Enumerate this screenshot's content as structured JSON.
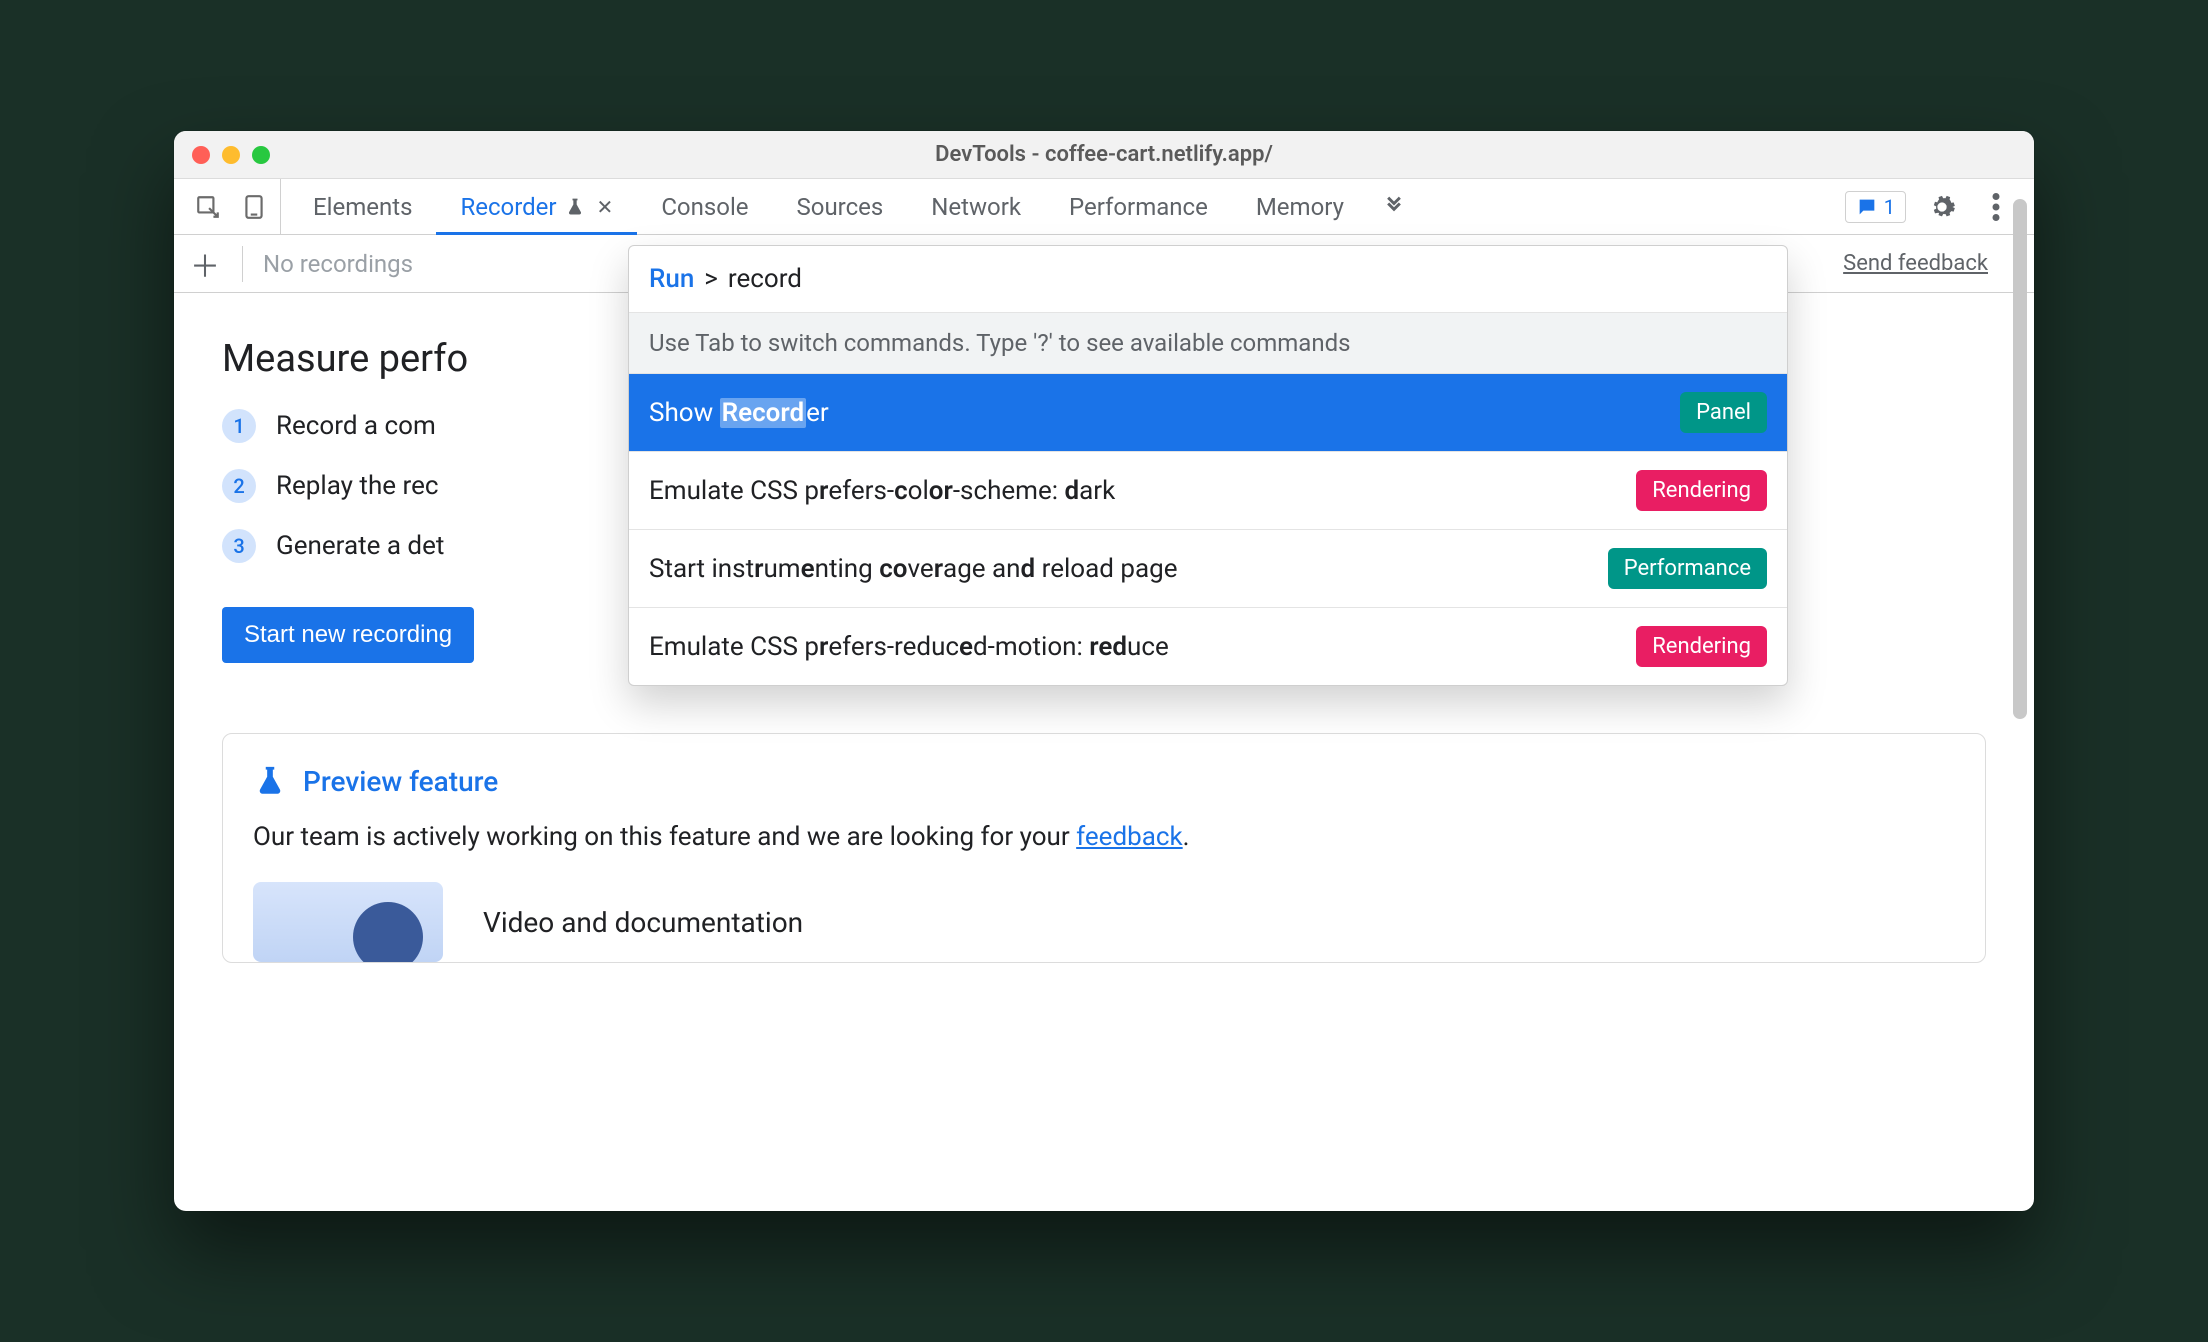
{
  "window": {
    "title": "DevTools - coffee-cart.netlify.app/"
  },
  "tabs": {
    "items": [
      "Elements",
      "Recorder",
      "Console",
      "Sources",
      "Network",
      "Performance",
      "Memory"
    ],
    "active_index": 1,
    "message_count": "1"
  },
  "subbar": {
    "no_recordings": "No recordings",
    "send_feedback": "Send feedback"
  },
  "page": {
    "heading": "Measure perfo",
    "steps": [
      {
        "num": "1",
        "text": "Record a com"
      },
      {
        "num": "2",
        "text": "Replay the rec"
      },
      {
        "num": "3",
        "text": "Generate a det"
      }
    ],
    "start_button": "Start new recording"
  },
  "card": {
    "title": "Preview feature",
    "text_pre": "Our team is actively working on this feature and we are looking for your ",
    "feedback_link": "feedback",
    "text_post": ".",
    "media_title": "Video and documentation"
  },
  "cmd": {
    "run_label": "Run",
    "prefix": ">",
    "query": "record",
    "hint": "Use Tab to switch commands. Type '?' to see available commands",
    "items": [
      {
        "label_html": "Show <span class='hl-box'><b>Record</b></span>er",
        "badge": "Panel",
        "badge_class": "panel",
        "selected": true
      },
      {
        "label_html": "Emulate CSS p<b>r</b>efers-<b>c</b>ol<b>or</b>-scheme: <b>d</b>ark",
        "badge": "Rendering",
        "badge_class": "rendering",
        "selected": false
      },
      {
        "label_html": "Start inst<b>r</b>um<b>e</b>nting <b>co</b>ve<b>r</b>age an<b>d</b> reload page",
        "badge": "Performance",
        "badge_class": "perf",
        "selected": false
      },
      {
        "label_html": "Emulate CSS p<b>r</b>efers-reduc<b>e</b>d-motion: <b>red</b>uce",
        "badge": "Rendering",
        "badge_class": "rendering",
        "selected": false
      }
    ]
  }
}
